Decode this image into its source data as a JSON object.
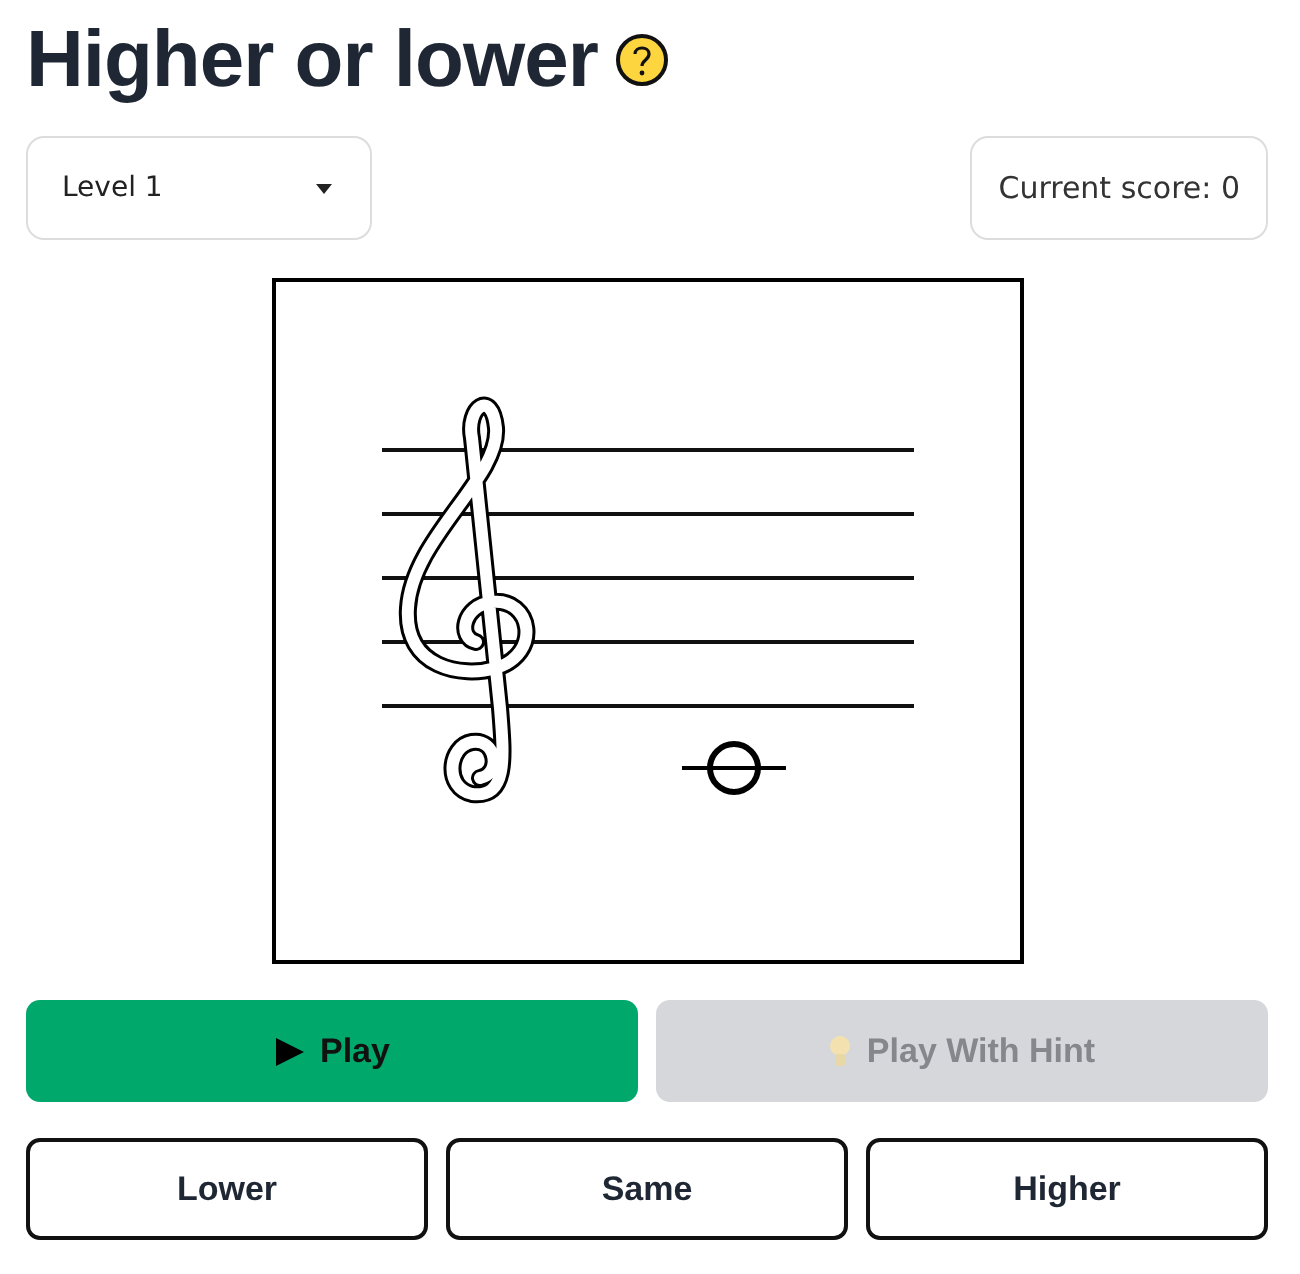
{
  "title": "Higher or lower",
  "level_select": {
    "value": "Level 1"
  },
  "score": "Current score: 0",
  "play_buttons": [
    {
      "kind": "play",
      "label": "Play",
      "disabled": false
    },
    {
      "kind": "hint",
      "label": "Play With Hint",
      "disabled": true
    }
  ],
  "answer_buttons": [
    "Lower",
    "Same",
    "Higher"
  ]
}
